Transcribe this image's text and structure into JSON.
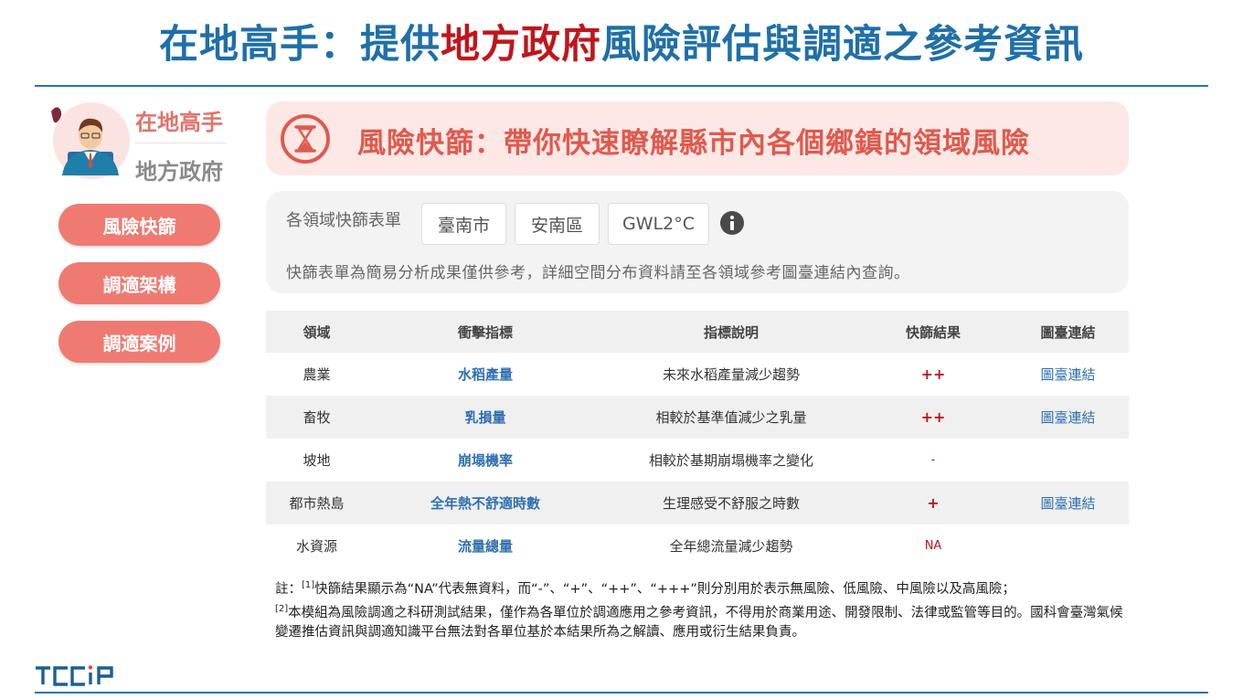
{
  "title": {
    "part1": "在地高手：提供",
    "highlight": "地方政府",
    "part2": "風險評估與調適之參考資訊"
  },
  "sidebar": {
    "heading": "在地高手",
    "subheading": "地方政府",
    "buttons": [
      "風險快篩",
      "調適架構",
      "調適案例"
    ]
  },
  "banner": {
    "icon": "hourglass-icon",
    "text": "風險快篩：帶你快速瞭解縣市內各個鄉鎮的領域風險"
  },
  "filters": {
    "label": "各領域快篩表單",
    "city": "臺南市",
    "district": "安南區",
    "gwl": "GWL2°C",
    "note": "快篩表單為簡易分析成果僅供參考，詳細空間分布資料請至各領域參考圖臺連結內查詢。"
  },
  "table": {
    "headers": [
      "領域",
      "衝擊指標",
      "指標說明",
      "快篩結果",
      "圖臺連結"
    ],
    "rows": [
      {
        "domain": "農業",
        "metric": "水稻產量",
        "desc": "未來水稻產量減少趨勢",
        "result": "++",
        "link": "圖臺連結"
      },
      {
        "domain": "畜牧",
        "metric": "乳損量",
        "desc": "相較於基準值減少之乳量",
        "result": "++",
        "link": "圖臺連結"
      },
      {
        "domain": "坡地",
        "metric": "崩塌機率",
        "desc": "相較於基期崩塌機率之變化",
        "result": "-",
        "link": ""
      },
      {
        "domain": "都市熱島",
        "metric": "全年熱不舒適時數",
        "desc": "生理感受不舒服之時數",
        "result": "+",
        "link": "圖臺連結"
      },
      {
        "domain": "水資源",
        "metric": "流量總量",
        "desc": "全年總流量減少趨勢",
        "result": "NA",
        "link": ""
      }
    ]
  },
  "notes": {
    "prefix": "註：",
    "sup1": "[1]",
    "text1": "快篩結果顯示為“NA”代表無資料，而“-”、“+”、“++”、“+++”則分別用於表示無風險、低風險、中風險以及高風險；",
    "sup2": "[2]",
    "text2": "本模組為風險調適之科研測試結果，僅作為各單位於調適應用之參考資訊，不得用於商業用途、開發限制、法律或監管等目的。國科會臺灣氣候變遷推估資訊與調適知識平台無法對各單位基於本結果所為之解讀、應用或衍生結果負責。"
  },
  "footer": {
    "logo": "TCCIP"
  },
  "colors": {
    "title_blue": "#1f6fa8",
    "accent_red": "#c0161c",
    "salmon": "#ef7a72"
  }
}
